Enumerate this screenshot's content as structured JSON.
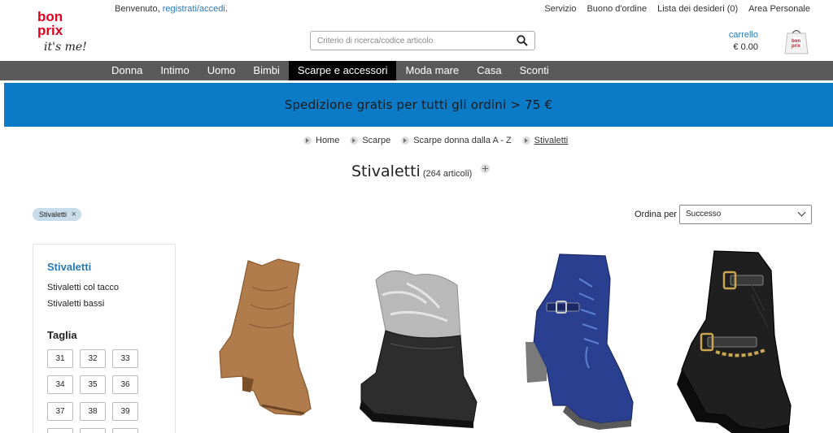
{
  "logo": {
    "line1": "bon",
    "line2": "prix",
    "tagline": "it's me!"
  },
  "header": {
    "welcome_prefix": "Benvenuto,",
    "welcome_link": "registrati/accedi",
    "welcome_suffix": ".",
    "top_links": [
      "Servizio",
      "Buono d'ordine",
      "Lista dei desideri (0)",
      "Area Personale"
    ],
    "search_placeholder": "Criterio di ricerca/codice articolo",
    "cart_label": "carrello",
    "cart_amount": "€ 0.00"
  },
  "nav": {
    "items": [
      "Donna",
      "Intimo",
      "Uomo",
      "Bimbi",
      "Scarpe e accessori",
      "Moda mare",
      "Casa",
      "Sconti"
    ],
    "active_index": 4
  },
  "banner": {
    "text": "Spedizione gratis per tutti gli ordini > 75 €"
  },
  "breadcrumb": [
    "Home",
    "Scarpe",
    "Scarpe donna dalla A - Z",
    "Stivaletti"
  ],
  "page": {
    "title": "Stivaletti",
    "count": "(264 articoli)"
  },
  "filter_chip": {
    "label": "Stivaletti",
    "close": "×"
  },
  "sort": {
    "label": "Ordina per",
    "selected": "Successo"
  },
  "sidebar": {
    "title": "Stivaletti",
    "links": [
      "Stivaletti col tacco",
      "Stivaletti bassi"
    ],
    "size_heading": "Taglia",
    "sizes": [
      "31",
      "32",
      "33",
      "34",
      "35",
      "36",
      "37",
      "38",
      "39"
    ]
  },
  "products": [
    {
      "icon": "cowboy-boot-brown",
      "color": "#b07c4c"
    },
    {
      "icon": "fur-boot-black",
      "color": "#2a2a2a"
    },
    {
      "icon": "lace-up-boot-blue",
      "color": "#2a3f8f"
    },
    {
      "icon": "buckle-boot-black",
      "color": "#1f1f1f"
    }
  ],
  "colors": {
    "accent": "#2a7ab8",
    "brand_red": "#e2001a",
    "banner": "#0b7bc7",
    "nav": "#5a5a5a"
  }
}
